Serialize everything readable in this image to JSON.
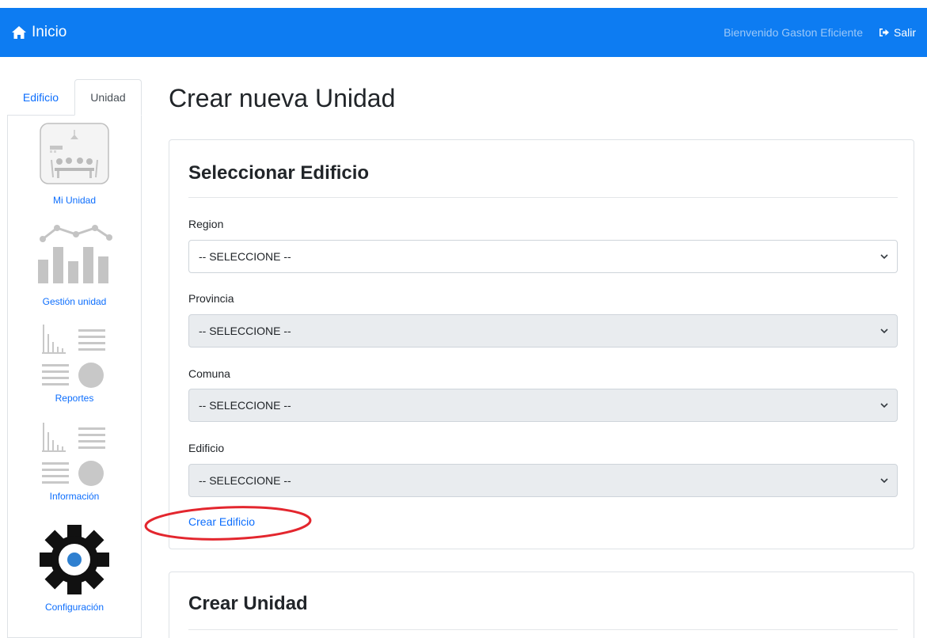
{
  "navbar": {
    "brand_label": "Inicio",
    "welcome_text": "Bienvenido Gaston Eficiente",
    "logout_label": "Salir"
  },
  "sidebar": {
    "tabs": [
      {
        "label": "Edificio",
        "active": false
      },
      {
        "label": "Unidad",
        "active": true
      }
    ],
    "items": [
      {
        "label": "Mi Unidad",
        "icon": "meeting-room-icon"
      },
      {
        "label": "Gestión unidad",
        "icon": "bar-line-chart-icon"
      },
      {
        "label": "Reportes",
        "icon": "reports-icon"
      },
      {
        "label": "Información",
        "icon": "info-report-icon"
      },
      {
        "label": "Configuración",
        "icon": "gear-icon"
      }
    ]
  },
  "main": {
    "page_title": "Crear nueva Unidad",
    "select_card": {
      "title": "Seleccionar Edificio",
      "fields": [
        {
          "label": "Region",
          "value": "-- SELECCIONE --",
          "disabled": false
        },
        {
          "label": "Provincia",
          "value": "-- SELECCIONE --",
          "disabled": true
        },
        {
          "label": "Comuna",
          "value": "-- SELECCIONE --",
          "disabled": true
        },
        {
          "label": "Edificio",
          "value": "-- SELECCIONE --",
          "disabled": true
        }
      ],
      "create_link": "Crear Edificio"
    },
    "unit_card": {
      "title": "Crear Unidad"
    }
  },
  "colors": {
    "navbar": "#0d7cf2",
    "link": "#0d6efd",
    "annotation": "#e3262e"
  }
}
